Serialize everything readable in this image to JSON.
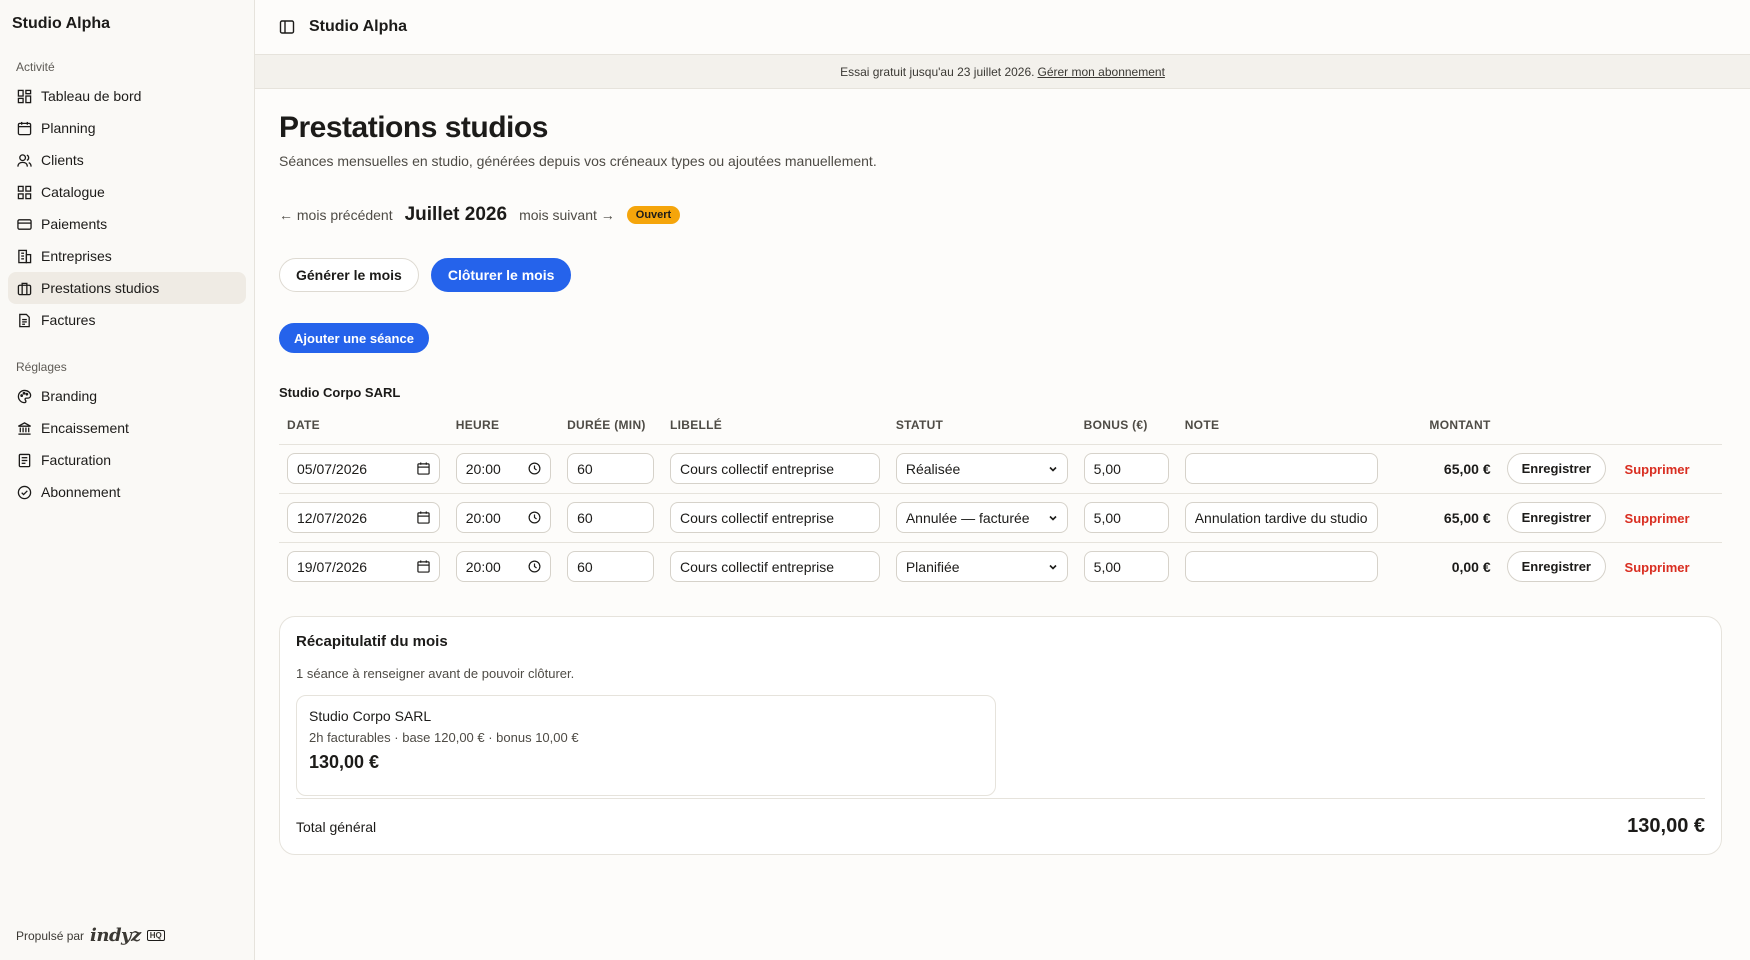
{
  "sidebar": {
    "title": "Studio Alpha",
    "section_activity": "Activité",
    "activity_items": [
      {
        "label": "Tableau de bord",
        "icon": "dashboard-icon"
      },
      {
        "label": "Planning",
        "icon": "calendar-icon"
      },
      {
        "label": "Clients",
        "icon": "users-icon"
      },
      {
        "label": "Catalogue",
        "icon": "grid-icon"
      },
      {
        "label": "Paiements",
        "icon": "credit-card-icon"
      },
      {
        "label": "Entreprises",
        "icon": "building-icon"
      },
      {
        "label": "Prestations studios",
        "icon": "briefcase-icon",
        "active": true
      },
      {
        "label": "Factures",
        "icon": "document-icon"
      }
    ],
    "section_settings": "Réglages",
    "settings_items": [
      {
        "label": "Branding",
        "icon": "palette-icon"
      },
      {
        "label": "Encaissement",
        "icon": "bank-icon"
      },
      {
        "label": "Facturation",
        "icon": "receipt-icon"
      },
      {
        "label": "Abonnement",
        "icon": "check-circle-icon"
      }
    ],
    "footer": {
      "prefix": "Propulsé par",
      "brand": "indyz",
      "badge": "HQ"
    }
  },
  "topbar": {
    "title": "Studio Alpha"
  },
  "banner": {
    "text": "Essai gratuit jusqu'au 23 juillet 2026.",
    "link": "Gérer mon abonnement"
  },
  "page": {
    "title": "Prestations studios",
    "subtitle": "Séances mensuelles en studio, générées depuis vos créneaux types ou ajoutées manuellement."
  },
  "month_nav": {
    "prev": "← mois précédent",
    "current": "Juillet 2026",
    "next": "mois suivant →",
    "status": "Ouvert"
  },
  "actions": {
    "generate": "Générer le mois",
    "close": "Clôturer le mois",
    "add_session": "Ajouter une séance"
  },
  "group": {
    "name": "Studio Corpo SARL",
    "columns": [
      "DATE",
      "HEURE",
      "DURÉE (MIN)",
      "LIBELLÉ",
      "STATUT",
      "BONUS (€)",
      "NOTE",
      "MONTANT"
    ],
    "save_label": "Enregistrer",
    "delete_label": "Supprimer",
    "rows": [
      {
        "date": "05/07/2026",
        "time": "20:00",
        "duration": "60",
        "label": "Cours collectif entreprise",
        "status": "Réalisée",
        "bonus": "5,00",
        "note": "",
        "amount": "65,00 €"
      },
      {
        "date": "12/07/2026",
        "time": "20:00",
        "duration": "60",
        "label": "Cours collectif entreprise",
        "status": "Annulée — facturée",
        "bonus": "5,00",
        "note": "Annulation tardive du studio",
        "amount": "65,00 €"
      },
      {
        "date": "19/07/2026",
        "time": "20:00",
        "duration": "60",
        "label": "Cours collectif entreprise",
        "status": "Planifiée",
        "bonus": "5,00",
        "note": "",
        "amount": "0,00 €"
      }
    ]
  },
  "summary": {
    "title": "Récapitulatif du mois",
    "warning": "1 séance à renseigner avant de pouvoir clôturer.",
    "client": {
      "name": "Studio Corpo SARL",
      "meta": "2h facturables · base 120,00 € · bonus 10,00 €",
      "total": "130,00 €"
    },
    "grand_total_label": "Total général",
    "grand_total_value": "130,00 €"
  },
  "colors": {
    "accent": "#2563eb",
    "status_open": "#f5a50b",
    "danger": "#d92d20",
    "active_bg": "#efebe4"
  }
}
